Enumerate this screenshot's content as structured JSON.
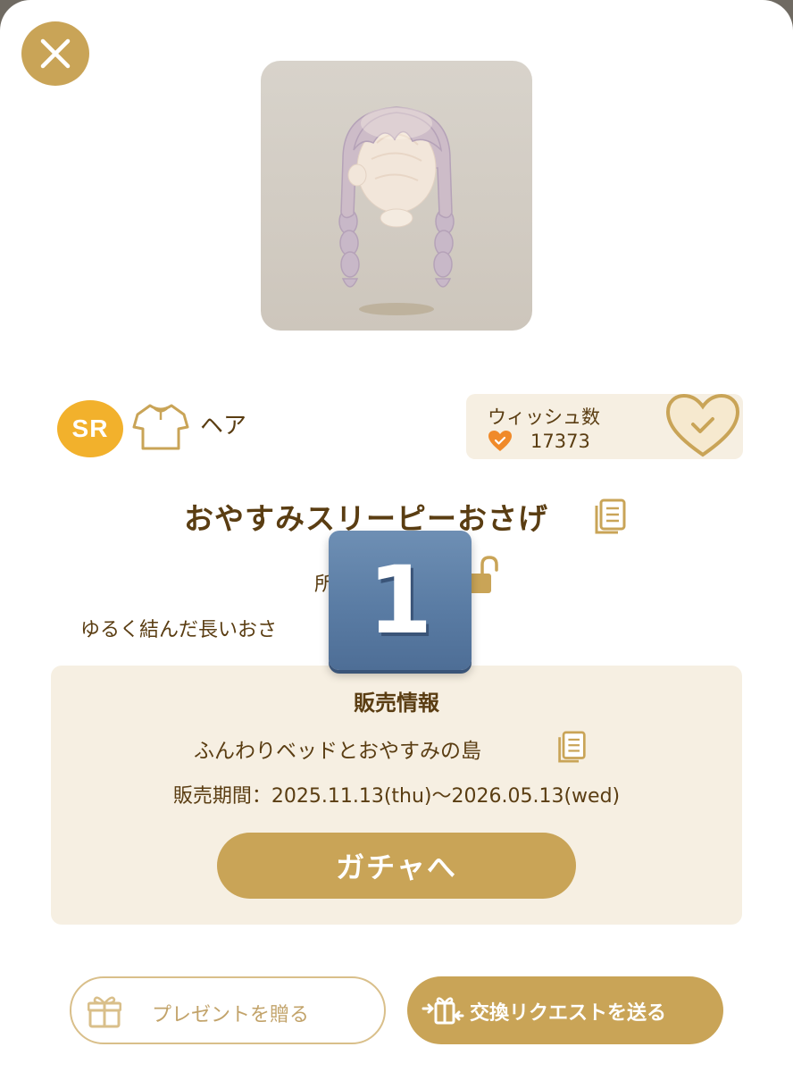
{
  "item": {
    "rarity": "SR",
    "category": "ヘア",
    "name": "おやすみスリーピーおさげ",
    "owned_text": "所",
    "description": "ゆるく結んだ長いおさ"
  },
  "wish": {
    "label": "ウィッシュ数",
    "count": "17373"
  },
  "sales": {
    "heading": "販売情報",
    "event": "ふんわりベッドとおやすみの島",
    "period": "販売期間：2025.11.13(thu)～2026.05.13(wed)",
    "gacha_button": "ガチャへ"
  },
  "actions": {
    "present": "プレゼントを贈る",
    "trade": "交換リクエストを送る"
  },
  "overlay": {
    "number": "1"
  },
  "colors": {
    "gold": "#c9a457",
    "rarity": "#f2b12c",
    "wish_heart": "#f08a2a",
    "panel": "#f6efe2",
    "text": "#5a3d12"
  },
  "icons": {
    "close": "close-icon",
    "category": "shirt-icon",
    "wish": "heart-check-icon",
    "copy": "copy-icon",
    "lock": "unlock-icon",
    "present": "gift-icon",
    "trade": "exchange-icon"
  }
}
